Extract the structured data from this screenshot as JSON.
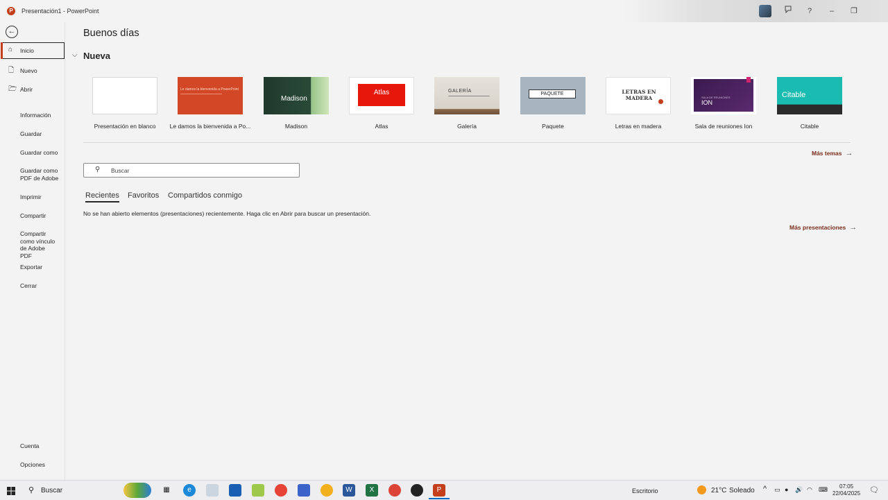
{
  "titlebar": {
    "title": "Presentación1 - PowerPoint",
    "app_logo": "P",
    "buttons": [
      "coauthor-icon",
      "help-icon",
      "minimize-icon",
      "restore-icon"
    ]
  },
  "nav": {
    "back": "←",
    "items": [
      {
        "label": "Inicio",
        "icon": "home-icon"
      },
      {
        "label": "Nuevo",
        "icon": "new-document-icon"
      },
      {
        "label": "Abrir",
        "icon": "folder-open-icon"
      },
      {
        "label": "Información"
      },
      {
        "label": "Guardar"
      },
      {
        "label": "Guardar como"
      },
      {
        "label": "Guardar como PDF de Adobe"
      },
      {
        "label": "Imprimir"
      },
      {
        "label": "Compartir"
      },
      {
        "label": "Compartir como vínculo de Adobe PDF"
      },
      {
        "label": "Exportar"
      },
      {
        "label": "Cerrar"
      }
    ],
    "footer": [
      {
        "label": "Cuenta"
      },
      {
        "label": "Opciones"
      }
    ]
  },
  "main": {
    "greeting": "Buenos días",
    "new_section": "Nueva",
    "templates": [
      {
        "label": "Presentación en blanco"
      },
      {
        "label": "Le damos la bienvenida a Po...",
        "thumb_text": "Le damos la bienvenida a PowerPoint"
      },
      {
        "label": "Madison",
        "thumb_text": "Madison"
      },
      {
        "label": "Atlas",
        "thumb_text": "Atlas"
      },
      {
        "label": "Galería",
        "thumb_text": "GALERÍA"
      },
      {
        "label": "Paquete",
        "thumb_text": "PAQUETE"
      },
      {
        "label": "Letras en madera",
        "thumb_text": "LETRAS EN MADERA"
      },
      {
        "label": "Sala de reuniones Ion",
        "thumb_text": "ION",
        "thumb_subtext": "SALA DE REUNIONES"
      },
      {
        "label": "Citable",
        "thumb_text": "Citable"
      }
    ],
    "more_themes": "Más temas",
    "search_placeholder": "Buscar",
    "tabs": [
      "Recientes",
      "Favoritos",
      "Compartidos conmigo"
    ],
    "empty_message": "No se han abierto elementos (presentaciones) recientemente. Haga clic en Abrir para buscar un presentación.",
    "more_presentations": "Más presentaciones"
  },
  "taskbar": {
    "search": "Buscar",
    "desktop_label": "Escritorio",
    "weather_temp": "21°C",
    "weather_desc": "Soleado",
    "time": "07:05",
    "date": "22/04/2025"
  },
  "colors": {
    "accent": "#c43e1c",
    "link": "#7a2d1a"
  }
}
